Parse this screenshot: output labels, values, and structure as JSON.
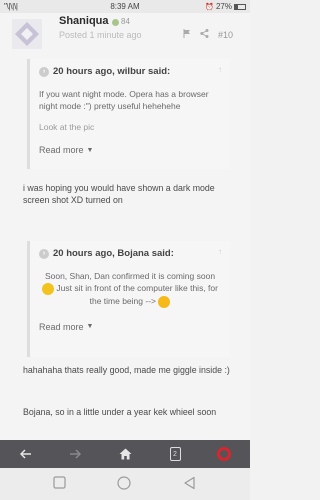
{
  "status_bar": {
    "carrier": "\"\\|\\|\\|",
    "time": "8:39 AM",
    "battery": "27%"
  },
  "post": {
    "username": "Shaniqua",
    "points": "84",
    "time_ago": "Posted 1 minute ago",
    "number": "#10"
  },
  "quote1": {
    "header": "20 hours ago, wilbur said:",
    "line1": "If you want night mode. Opera has a browser night mode :\") pretty useful hehehehe",
    "line2": "Look at the pic",
    "read_more": "Read more"
  },
  "reply1": "i was hoping you would have shown a dark mode screen shot XD turned on",
  "quote2": {
    "header": "20 hours ago, Bojana said:",
    "line1": "Soon, Shan, Dan confirmed it is coming soon",
    "line2": "Just sit in front of the computer like this, for",
    "line3": "the time being -->",
    "read_more": "Read more"
  },
  "reply2": "hahahaha thats really good, made me giggle inside :)",
  "reply3": "Bojana, so in a  little under a year kek whieel soon",
  "browser_nav": {
    "tab_count": "2"
  },
  "colors": {
    "navbar": "#545459",
    "opera_red": "#d8262f",
    "online": "#a9c58b"
  }
}
